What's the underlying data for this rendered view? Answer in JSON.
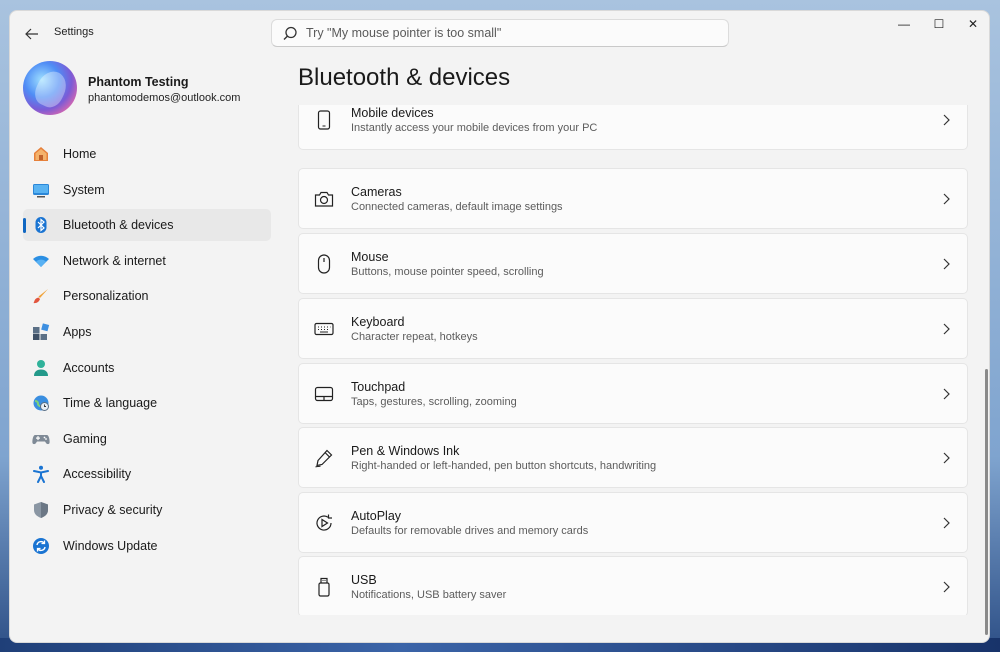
{
  "window": {
    "app_title": "Settings",
    "controls": {
      "minimize": "—",
      "maximize": "☐",
      "close": "✕"
    }
  },
  "search": {
    "placeholder": "Try \"My mouse pointer is too small\""
  },
  "profile": {
    "name": "Phantom Testing",
    "email": "phantomodemos@outlook.com"
  },
  "sidebar": {
    "items": [
      {
        "label": "Home",
        "icon": "home-icon"
      },
      {
        "label": "System",
        "icon": "system-icon"
      },
      {
        "label": "Bluetooth & devices",
        "icon": "bluetooth-icon",
        "selected": true
      },
      {
        "label": "Network & internet",
        "icon": "wifi-icon"
      },
      {
        "label": "Personalization",
        "icon": "brush-icon"
      },
      {
        "label": "Apps",
        "icon": "apps-icon"
      },
      {
        "label": "Accounts",
        "icon": "accounts-icon"
      },
      {
        "label": "Time & language",
        "icon": "globe-clock-icon"
      },
      {
        "label": "Gaming",
        "icon": "gamepad-icon"
      },
      {
        "label": "Accessibility",
        "icon": "accessibility-icon"
      },
      {
        "label": "Privacy & security",
        "icon": "shield-icon"
      },
      {
        "label": "Windows Update",
        "icon": "update-icon"
      }
    ]
  },
  "main": {
    "title": "Bluetooth & devices",
    "cards": [
      {
        "title": "Mobile devices",
        "subtitle": "Instantly access your mobile devices from your PC",
        "icon": "phone-icon"
      },
      {
        "title": "Cameras",
        "subtitle": "Connected cameras, default image settings",
        "icon": "camera-icon"
      },
      {
        "title": "Mouse",
        "subtitle": "Buttons, mouse pointer speed, scrolling",
        "icon": "mouse-icon"
      },
      {
        "title": "Keyboard",
        "subtitle": "Character repeat, hotkeys",
        "icon": "keyboard-icon"
      },
      {
        "title": "Touchpad",
        "subtitle": "Taps, gestures, scrolling, zooming",
        "icon": "touchpad-icon"
      },
      {
        "title": "Pen & Windows Ink",
        "subtitle": "Right-handed or left-handed, pen button shortcuts, handwriting",
        "icon": "pen-icon"
      },
      {
        "title": "AutoPlay",
        "subtitle": "Defaults for removable drives and memory cards",
        "icon": "autoplay-icon"
      },
      {
        "title": "USB",
        "subtitle": "Notifications, USB battery saver",
        "icon": "usb-icon"
      }
    ]
  },
  "colors": {
    "accent": "#1067c2",
    "background": "#f3f3f3",
    "card": "#fbfbfb"
  }
}
